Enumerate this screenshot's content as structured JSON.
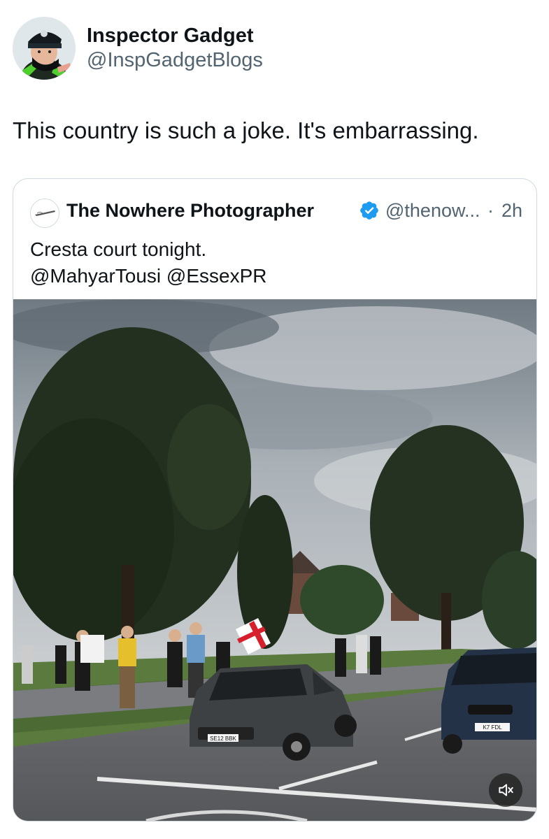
{
  "author": {
    "display_name": "Inspector Gadget",
    "handle": "@InspGadgetBlogs"
  },
  "tweet": {
    "text": "This country is such a joke. It's embarrassing."
  },
  "quoted_tweet": {
    "display_name": "The Nowhere Photographer",
    "handle": "@thenow...",
    "separator": "·",
    "time": "2h",
    "line1": "Cresta court tonight.",
    "line2": "@MahyarTousi @EssexPR",
    "verified": true,
    "media": {
      "type": "video",
      "muted": true,
      "plate_left": "SE12 BBK",
      "plate_right": "K7 FDL"
    }
  },
  "colors": {
    "text_primary": "#0f1419",
    "text_secondary": "#536471",
    "border": "#cfd9de",
    "verified_blue": "#1d9bf0"
  },
  "icons": {
    "verified": "verified-badge-icon",
    "mute": "speaker-muted-icon"
  }
}
